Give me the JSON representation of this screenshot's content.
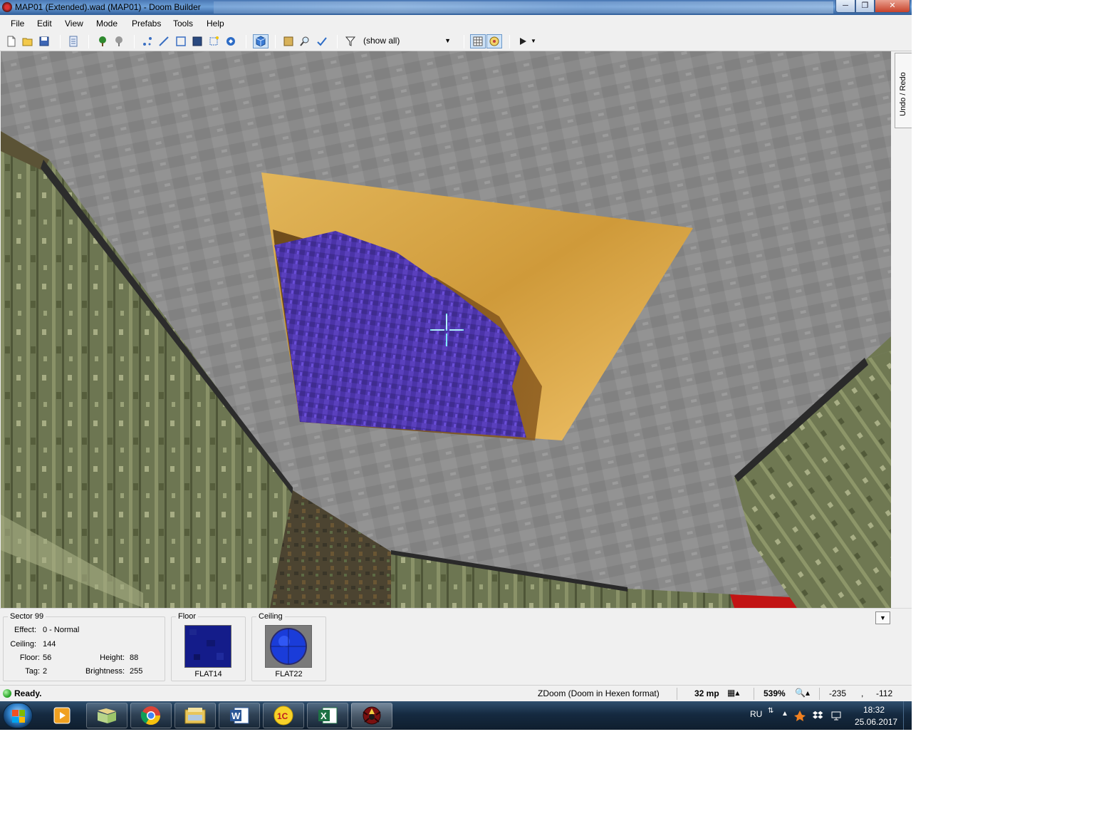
{
  "window": {
    "title": "MAP01 (Extended).wad (MAP01) - Doom Builder",
    "minimize_icon": "minimize-icon",
    "maximize_icon": "maximize-icon",
    "close_icon": "close-icon"
  },
  "menu": {
    "items": [
      "File",
      "Edit",
      "View",
      "Mode",
      "Prefabs",
      "Tools",
      "Help"
    ]
  },
  "toolbar": {
    "filter_value": "(show all)",
    "icons": [
      "new-map-icon",
      "open-map-icon",
      "save-map-icon",
      "script-editor-icon",
      "things-filter-icon",
      "things-filter-off-icon",
      "vertices-mode-icon",
      "linedefs-mode-icon",
      "sectors-mode-icon",
      "things-mode-icon",
      "make-sectors-icon",
      "visual-mode-icon",
      "3d-mode-icon",
      "prefab-icon",
      "find-icon",
      "map-analysis-icon",
      "filter-icon",
      "grid-icon",
      "texture-view-icon",
      "test-map-icon"
    ]
  },
  "dock": {
    "undo_tab": "Undo / Redo"
  },
  "info_panel": {
    "sector_title": "Sector 99",
    "effect_label": "Effect:",
    "effect_value": "0 - Normal",
    "ceiling_label": "Ceiling:",
    "ceiling_value": "144",
    "floor_label": "Floor:",
    "floor_value": "56",
    "height_label": "Height:",
    "height_value": "88",
    "tag_label": "Tag:",
    "tag_value": "2",
    "brightness_label": "Brightness:",
    "brightness_value": "255",
    "floor_title": "Floor",
    "floor_texture": "FLAT14",
    "ceiling_title": "Ceiling",
    "ceiling_texture": "FLAT22"
  },
  "status": {
    "ready": "Ready.",
    "game_config": "ZDoom (Doom in Hexen format)",
    "grid_size": "32 mp",
    "zoom": "539%",
    "coord_x": "-235",
    "coord_sep": ",",
    "coord_y": "-112"
  },
  "taskbar": {
    "apps": [
      "media-player-icon",
      "file-manager-icon",
      "chrome-icon",
      "explorer-icon",
      "word-icon",
      "1c-icon",
      "excel-icon",
      "doom-builder-icon"
    ],
    "language": "RU",
    "time": "18:32",
    "date": "25.06.2017"
  },
  "colors": {
    "ceiling_gray": "#8a8a8a",
    "wall_green": "#6f7850",
    "skylight_purple": "#4b34a8",
    "skylight_gold": "#d9a646",
    "crosshair": "#7ee7f5",
    "floor_texture": "#141c8a",
    "ceiling_texture": "#1a3cd9"
  }
}
